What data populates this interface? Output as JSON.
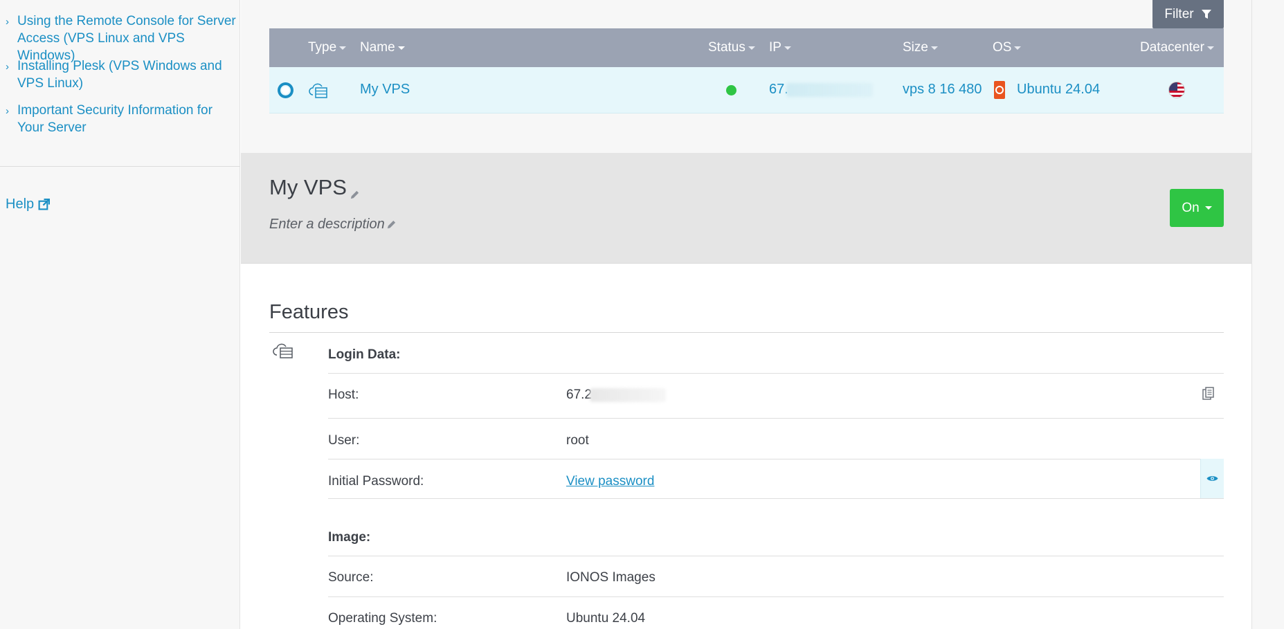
{
  "sidebar": {
    "links": [
      {
        "label": "Using the Remote Console for Server Access (VPS Linux and VPS Windows)"
      },
      {
        "label": "Installing Plesk (VPS Windows and VPS Linux)"
      },
      {
        "label": "Important Security Information for Your Server"
      }
    ],
    "help_label": "Help"
  },
  "list": {
    "filter_label": "Filter",
    "columns": {
      "type": "Type",
      "name": "Name",
      "status": "Status",
      "ip": "IP",
      "size": "Size",
      "os": "OS",
      "datacenter": "Datacenter"
    },
    "row": {
      "name": "My VPS",
      "status_color": "#2fc544",
      "ip_visible": "67.",
      "size": "vps 8 16 480",
      "os": "Ubuntu 24.04",
      "datacenter_icon": "us-flag-icon"
    }
  },
  "detail": {
    "title": "My VPS",
    "description_placeholder": "Enter a description",
    "power_label": "On"
  },
  "features": {
    "title": "Features",
    "login_data": {
      "heading": "Login Data:",
      "host_label": "Host:",
      "host_value_visible": "67.2",
      "user_label": "User:",
      "user_value": "root",
      "password_label": "Initial Password:",
      "password_link": "View password"
    },
    "image": {
      "heading": "Image:",
      "source_label": "Source:",
      "source_value": "IONOS Images",
      "os_label": "Operating System:",
      "os_value": "Ubuntu 24.04"
    }
  },
  "colors": {
    "accent": "#1b8fc4",
    "header_bg": "#9ba3b3",
    "filter_bg": "#677181",
    "power_on": "#2fc544",
    "row_selected": "#e6f7fb"
  }
}
